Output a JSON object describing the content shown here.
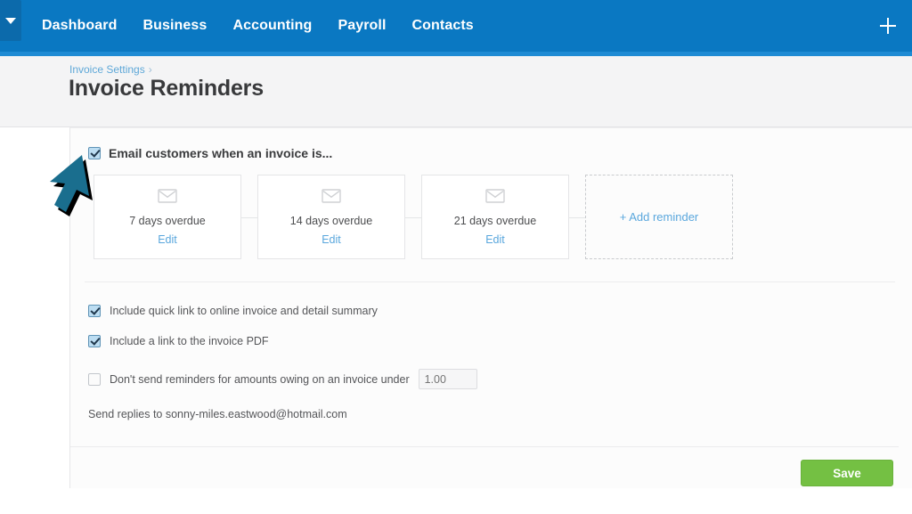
{
  "nav": {
    "logo_icon": "caret-down-icon",
    "items": [
      {
        "label": "Dashboard"
      },
      {
        "label": "Business"
      },
      {
        "label": "Accounting"
      },
      {
        "label": "Payroll"
      },
      {
        "label": "Contacts"
      }
    ],
    "add_icon": "plus-icon",
    "bar_color": "#0a78c2"
  },
  "header": {
    "breadcrumb": "Invoice Settings",
    "breadcrumb_separator": "›",
    "title": "Invoice Reminders"
  },
  "main": {
    "enable_email": {
      "label": "Email customers when an invoice is...",
      "checked": true
    },
    "reminders": [
      {
        "icon": "envelope-icon",
        "label": "7 days overdue",
        "edit_label": "Edit"
      },
      {
        "icon": "envelope-icon",
        "label": "14 days overdue",
        "edit_label": "Edit"
      },
      {
        "icon": "envelope-icon",
        "label": "21 days overdue",
        "edit_label": "Edit"
      }
    ],
    "add_reminder_label": "+ Add reminder",
    "options": [
      {
        "label": "Include quick link to online invoice and detail summary",
        "checked": true
      },
      {
        "label": "Include a link to the invoice PDF",
        "checked": true
      },
      {
        "label": "Don't send reminders for amounts owing on an invoice under",
        "checked": false
      }
    ],
    "amount_field": {
      "value": "",
      "placeholder": "1.00"
    },
    "reply_to_text": "Send replies to sonny-miles.eastwood@hotmail.com"
  },
  "footer": {
    "save_label": "Save",
    "save_color": "#74c043"
  },
  "overlay": {
    "cursor_icon": "mouse-pointer-arrow",
    "cursor_color": "#1a6e8e"
  }
}
